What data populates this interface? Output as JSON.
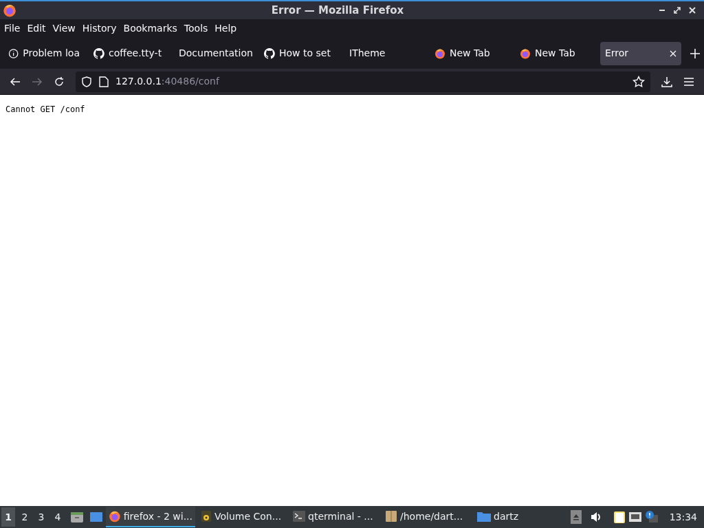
{
  "window": {
    "title": "Error — Mozilla Firefox"
  },
  "menu": [
    "File",
    "Edit",
    "View",
    "History",
    "Bookmarks",
    "Tools",
    "Help"
  ],
  "tabs": [
    {
      "label": "Problem loa",
      "kind": "info",
      "selected": false
    },
    {
      "label": "coffee.tty-t",
      "kind": "github",
      "selected": false
    },
    {
      "label": "Documentation",
      "kind": "plain",
      "selected": false
    },
    {
      "label": "How to set",
      "kind": "github",
      "selected": false
    },
    {
      "label": "ITheme",
      "kind": "plain",
      "selected": false
    },
    {
      "label": "New Tab",
      "kind": "firefox",
      "selected": false
    },
    {
      "label": "New Tab",
      "kind": "firefox",
      "selected": false
    },
    {
      "label": "Error",
      "kind": "plain",
      "selected": true
    }
  ],
  "address": {
    "host": "127.0.0.1",
    "path": ":40486/conf"
  },
  "page": {
    "text": "Cannot GET /conf"
  },
  "taskbar": {
    "workspaces": [
      {
        "label": "1",
        "selected": true
      },
      {
        "label": "2",
        "selected": false
      },
      {
        "label": "3",
        "selected": false
      },
      {
        "label": "4",
        "selected": false
      }
    ],
    "tasks": [
      {
        "label": "firefox - 2 wi...",
        "kind": "firefox",
        "selected": true
      },
      {
        "label": "Volume Con...",
        "kind": "speaker",
        "selected": false
      },
      {
        "label": "qterminal - ...",
        "kind": "terminal",
        "selected": false
      },
      {
        "label": "/home/dart...",
        "kind": "package",
        "selected": false
      },
      {
        "label": "dartz",
        "kind": "folder",
        "selected": false
      }
    ],
    "clock": "13:34"
  }
}
